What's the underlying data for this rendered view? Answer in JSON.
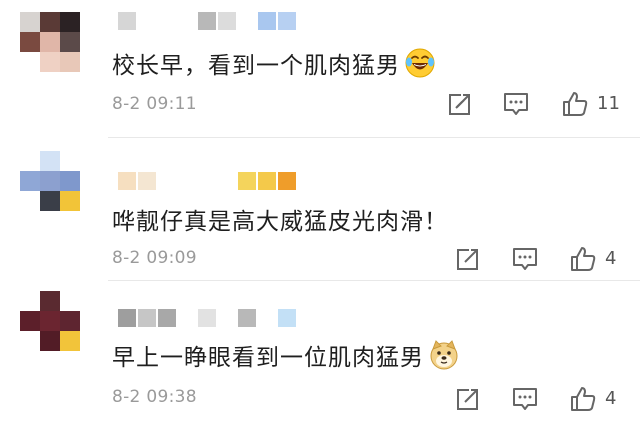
{
  "comments": [
    {
      "text": "校长早，看到一个肌肉猛男",
      "emoji": "laughing-tears-emoji",
      "date": "8-2",
      "time": "09:11",
      "likes": "11",
      "avatar_colors": [
        "#d7d3d0",
        "#5a3a36",
        "#2b2224",
        "#7a4a40",
        "#e0b6a8",
        "#5b4a49",
        "#ffffff",
        "#efd1c4",
        "#e8c8b8"
      ],
      "username_colors": [
        "#d6d6d6",
        "#ffffff",
        "#ffffff",
        "#ffffff",
        "#b8b8b8",
        "#dcdcdc",
        "#ffffff",
        "#a9c7ef",
        "#b7d0f2"
      ]
    },
    {
      "text": "哗靓仔真是高大威猛皮光肉滑！",
      "emoji": "",
      "date": "8-2",
      "time": "09:09",
      "likes": "4",
      "avatar_colors": [
        "#ffffff",
        "#d3e2f5",
        "#ffffff",
        "#8fa7d6",
        "#8ca0cf",
        "#7f98cc",
        "#ffffff",
        "#3a3e48",
        "#f2c438"
      ],
      "username_colors": [
        "#f6dfc0",
        "#f4e6d2",
        "#ffffff",
        "#ffffff",
        "#ffffff",
        "#ffffff",
        "#f4d45c",
        "#f4c94a",
        "#ef9d2a"
      ]
    },
    {
      "text": "早上一睁眼看到一位肌肉猛男",
      "emoji": "doge-emoji",
      "date": "8-2",
      "time": "09:38",
      "likes": "4",
      "avatar_colors": [
        "#ffffff",
        "#5a2a30",
        "#ffffff",
        "#5c1f2a",
        "#6b2530",
        "#5e2530",
        "#ffffff",
        "#521c26",
        "#f2c43a"
      ],
      "username_colors": [
        "#9e9e9e",
        "#c6c6c6",
        "#a8a8a8",
        "#ffffff",
        "#e2e2e2",
        "#ffffff",
        "#b8b8b8",
        "#ffffff",
        "#c3e0f6"
      ]
    }
  ],
  "icons": {
    "share": "share-edit-icon",
    "comment": "comment-bubble-icon",
    "like": "thumbs-up-icon"
  }
}
